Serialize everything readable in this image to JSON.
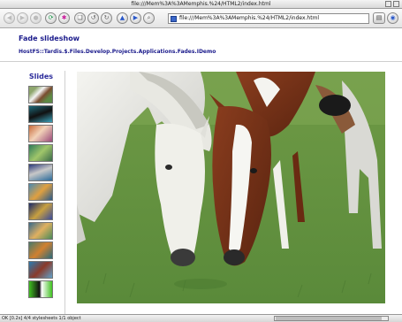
{
  "window": {
    "title": "file:///Mem%3A%3AMemphis.%24/HTML2/index.html"
  },
  "toolbar": {
    "buttons": [
      "back-icon",
      "forward-icon",
      "stop-icon",
      "reload-icon",
      "home-icon",
      "hotlist-icon",
      "history-back-icon",
      "history-forward-icon",
      "up-icon",
      "next-icon",
      "search-icon"
    ],
    "url": "file:///Mem%3A%3AMemphis.%24/HTML2/index.html",
    "colors": {
      "accent": "#2a58c8",
      "pink": "#c8209a",
      "green": "#0a8a3a"
    }
  },
  "page": {
    "title": "Fade slideshow",
    "path": "HostFS::Tardis.$.Files.Develop.Projects.Applications.Fades.IDemo",
    "sidebar_heading": "Slides",
    "thumbnail_count": 11,
    "main_image": "two horses grazing on grass"
  },
  "status": {
    "text": "OK [0.2s] 4/4 stylesheets 1/1 object"
  }
}
